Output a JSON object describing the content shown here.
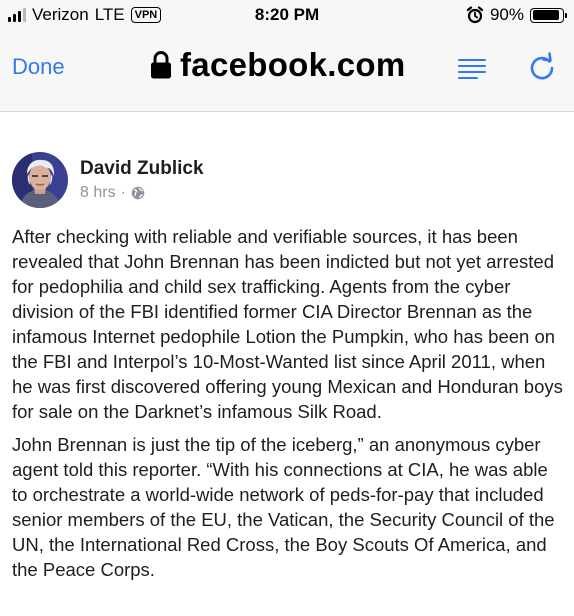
{
  "status_bar": {
    "carrier": "Verizon",
    "network": "LTE",
    "vpn_label": "VPN",
    "time": "8:20 PM",
    "battery": "90%",
    "battery_level": 0.9
  },
  "browser": {
    "done_label": "Done",
    "domain": "facebook.com",
    "icons": [
      "lock-icon",
      "reader-view-icon",
      "reload-icon"
    ]
  },
  "post": {
    "author": "David Zublick",
    "time_ago": "8 hrs",
    "separator": "·",
    "privacy_icon": "globe-icon",
    "paragraphs": [
      "After checking with reliable and verifiable sources, it has been revealed that John Brennan has been indicted but not yet arrested for pedophilia and child sex trafficking. Agents from the cyber division of the FBI identified former CIA Director Brennan as the infamous Internet pedophile Lotion the Pumpkin, who has been on the FBI and Interpol’s 10-Most-Wanted list since April 2011, when he was first discovered offering young Mexican and Honduran boys for sale on the Darknet’s infamous Silk Road.",
      "John Brennan is just the tip of the iceberg,” an anonymous cyber agent told this reporter. “With his connections at CIA, he was able to orchestrate a world-wide network of peds-for-pay that included senior members of the EU, the Vatican, the Security Council of the UN, the International Red Cross, the Boy Scouts Of America, and the Peace Corps."
    ]
  },
  "colors": {
    "accent_blue": "#3478f6",
    "meta_gray": "#90949c",
    "bar_background": "#f7f7f7"
  }
}
